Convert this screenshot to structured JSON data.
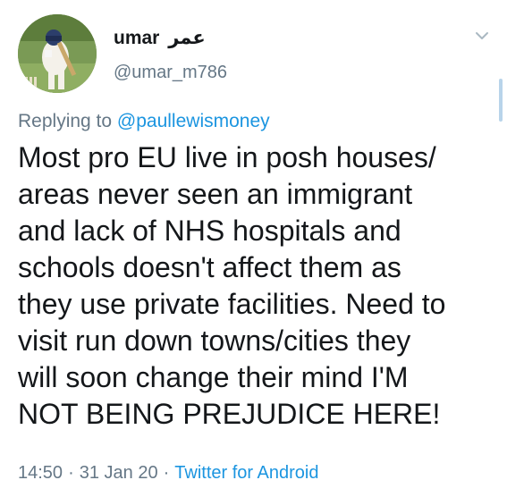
{
  "user": {
    "display_name": "umar",
    "display_name_arabic": "عمر",
    "handle": "@umar_m786"
  },
  "reply": {
    "prefix": "Replying to",
    "mention": "@paullewismoney"
  },
  "tweet": {
    "lines": [
      "Most pro EU live in posh houses/",
      "areas never seen an immigrant",
      "and lack of NHS hospitals and",
      "schools doesn't affect them as",
      "they use private facilities. Need to",
      "visit run down towns/cities they",
      "will soon change their mind I'M",
      "NOT BEING PREJUDICE HERE!"
    ]
  },
  "meta": {
    "time": "14:50",
    "separator": "·",
    "date": "31 Jan 20",
    "source": "Twitter for Android"
  },
  "icons": {
    "menu": "chevron-down-icon",
    "avatar": "avatar"
  },
  "colors": {
    "text": "#14171a",
    "secondary": "#657786",
    "link": "#1b95e0"
  }
}
